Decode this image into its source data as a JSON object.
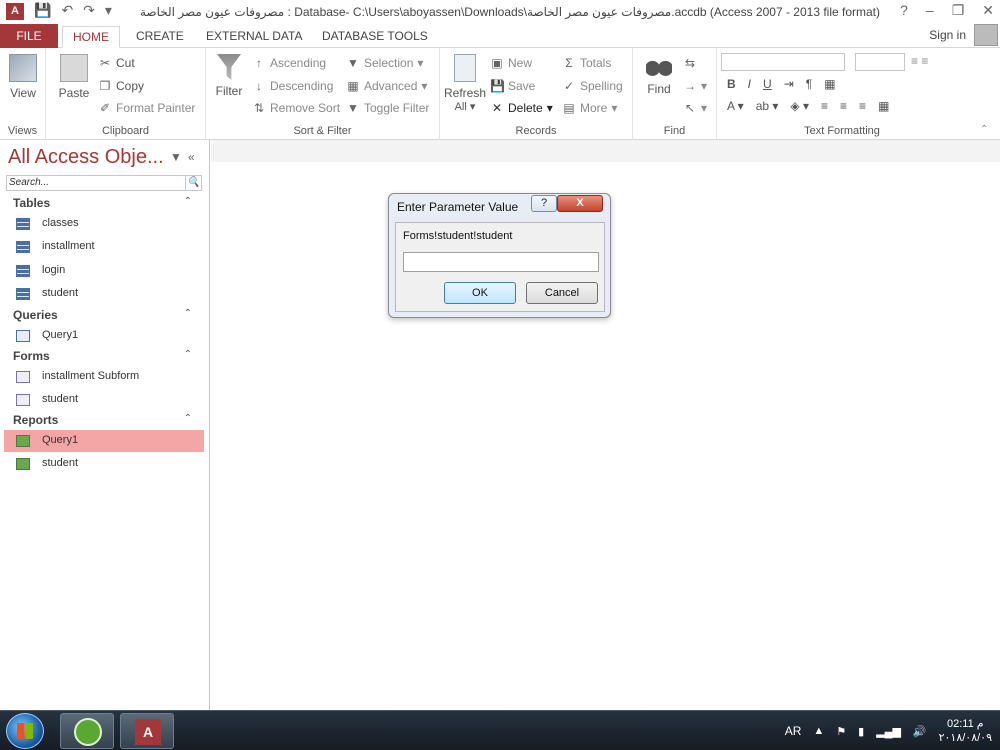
{
  "window": {
    "title": "مصروفات عيون مصر الخاصة : Database- C:\\Users\\aboyassen\\Downloads\\مصروفات عيون مصر الخاصة.accdb (Access 2007 - 2013 file format) - Ac...",
    "help": "?"
  },
  "tabs": {
    "file": "FILE",
    "home": "HOME",
    "create": "CREATE",
    "external": "EXTERNAL DATA",
    "dbtools": "DATABASE TOOLS",
    "signin": "Sign in"
  },
  "ribbon": {
    "views": {
      "view": "View",
      "label": "Views"
    },
    "clipboard": {
      "paste": "Paste",
      "cut": "Cut",
      "copy": "Copy",
      "format_painter": "Format Painter",
      "label": "Clipboard"
    },
    "sort_filter": {
      "filter": "Filter",
      "ascending": "Ascending",
      "descending": "Descending",
      "remove_sort": "Remove Sort",
      "selection": "Selection",
      "advanced": "Advanced",
      "toggle_filter": "Toggle Filter",
      "label": "Sort & Filter"
    },
    "records": {
      "refresh": "Refresh",
      "refresh_all": "All",
      "new": "New",
      "save": "Save",
      "delete": "Delete",
      "totals": "Totals",
      "spelling": "Spelling",
      "more": "More",
      "label": "Records"
    },
    "find": {
      "find": "Find",
      "label": "Find"
    },
    "text_formatting": {
      "bold": "B",
      "italic": "I",
      "underline": "U",
      "label": "Text Formatting"
    }
  },
  "nav": {
    "title": "All Access Obje...",
    "search_placeholder": "Search...",
    "sections": [
      {
        "label": "Tables",
        "items": [
          "classes",
          "installment",
          "login",
          "student"
        ]
      },
      {
        "label": "Queries",
        "items": [
          "Query1"
        ]
      },
      {
        "label": "Forms",
        "items": [
          "installment Subform",
          "student"
        ]
      },
      {
        "label": "Reports",
        "items": [
          "Query1",
          "student"
        ]
      }
    ],
    "selected": "Reports/Query1"
  },
  "dialog": {
    "title": "Enter Parameter Value",
    "help": "?",
    "close": "X",
    "prompt": "Forms!student!student",
    "input_value": "",
    "ok": "OK",
    "cancel": "Cancel"
  },
  "taskbar": {
    "access_icon_letter": "A",
    "language": "AR",
    "time": "02:11 م",
    "date": "٢٠١٨/٠٨/٠٩"
  }
}
